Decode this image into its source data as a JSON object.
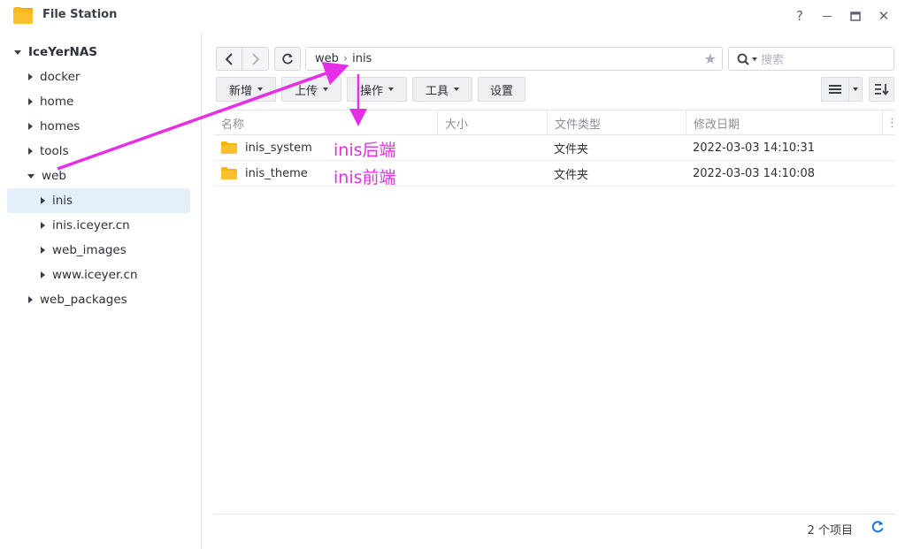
{
  "window": {
    "title": "File Station",
    "help": "?",
    "minimize": "—",
    "maximize": "▭",
    "close": "✕"
  },
  "sidebar": {
    "root": "IceYerNAS",
    "items": [
      {
        "label": "docker"
      },
      {
        "label": "home"
      },
      {
        "label": "homes"
      },
      {
        "label": "tools"
      },
      {
        "label": "web"
      },
      {
        "label": "inis"
      },
      {
        "label": "inis.iceyer.cn"
      },
      {
        "label": "web_images"
      },
      {
        "label": "www.iceyer.cn"
      },
      {
        "label": "web_packages"
      }
    ]
  },
  "path": {
    "segments": [
      "web",
      "inis"
    ],
    "separator": "›"
  },
  "search": {
    "placeholder": "搜索"
  },
  "toolbar": {
    "create": "新增",
    "upload": "上传",
    "action": "操作",
    "tools": "工具",
    "settings": "设置"
  },
  "table": {
    "columns": [
      "名称",
      "大小",
      "文件类型",
      "修改日期"
    ],
    "rows": [
      {
        "name": "inis_system",
        "size": "",
        "type": "文件夹",
        "modified": "2022-03-03 14:10:31"
      },
      {
        "name": "inis_theme",
        "size": "",
        "type": "文件夹",
        "modified": "2022-03-03 14:10:08"
      }
    ]
  },
  "annotations": {
    "backend": "inis后端",
    "frontend": "inis前端"
  },
  "footer": {
    "count": "2 个项目"
  },
  "colors": {
    "accent": "#1a73d9",
    "folder": "#f5b400",
    "annotation": "#e62ee6",
    "selected_bg": "#e4effc"
  }
}
